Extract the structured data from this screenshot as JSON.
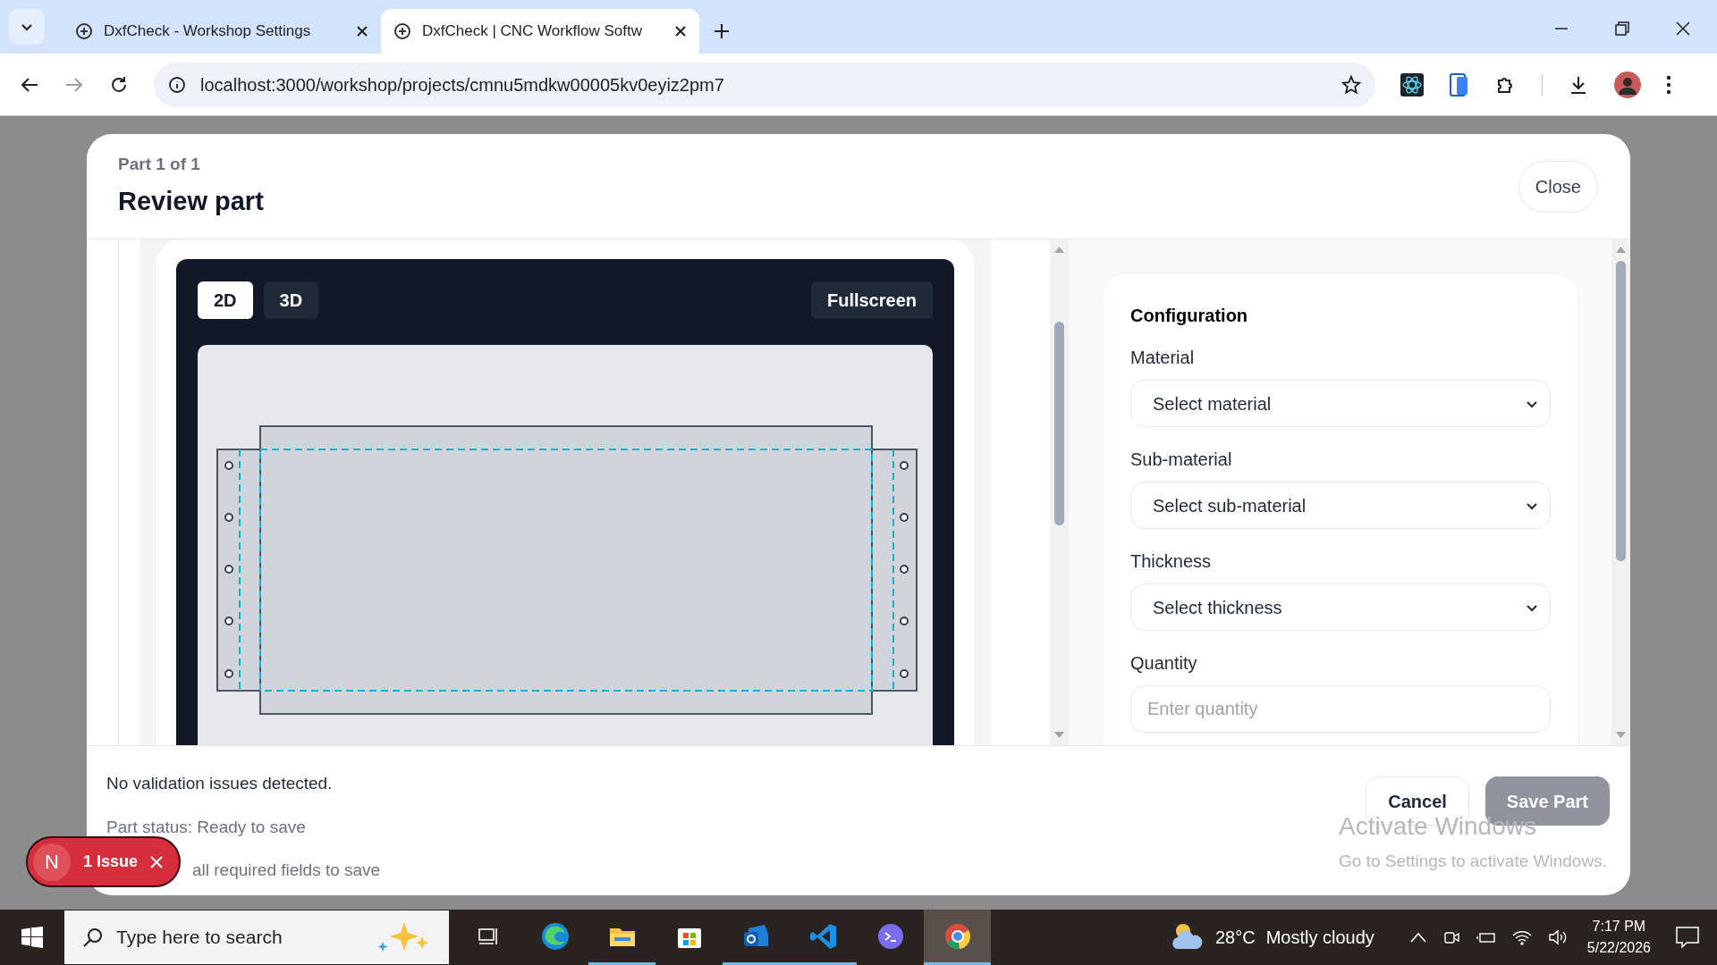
{
  "browser": {
    "tabs": [
      {
        "title": "DxfCheck - Workshop Settings",
        "selected": false
      },
      {
        "title": "DxfCheck | CNC Workflow Softw",
        "selected": true
      }
    ],
    "url": "localhost:3000/workshop/projects/cmnu5mdkw00005kv0eyiz2pm7"
  },
  "modal": {
    "subtitle": "Part 1 of 1",
    "title": "Review part",
    "close": "Close"
  },
  "viewer": {
    "modes": [
      {
        "label": "2D",
        "selected": true
      },
      {
        "label": "3D",
        "selected": false
      }
    ],
    "fullscreen": "Fullscreen"
  },
  "configuration": {
    "title": "Configuration",
    "fields": [
      {
        "label": "Material",
        "kind": "select",
        "value": "Select material"
      },
      {
        "label": "Sub-material",
        "kind": "select",
        "value": "Select sub-material"
      },
      {
        "label": "Thickness",
        "kind": "select",
        "value": "Select thickness"
      },
      {
        "label": "Quantity",
        "kind": "input",
        "placeholder": "Enter quantity"
      }
    ]
  },
  "footer": {
    "messages": [
      "No validation issues detected.",
      "Part status: Ready to save",
      "all required fields to save"
    ],
    "cancel": "Cancel",
    "save": {
      "label": "Save Part",
      "disabled": true
    }
  },
  "issue_badge": {
    "letter": "N",
    "label": "1 Issue"
  },
  "os_notice": {
    "title": "Activate Windows",
    "text": "Go to Settings to activate Windows."
  },
  "taskbar": {
    "search_placeholder": "Type here to search",
    "temperature": "28°C",
    "weather": "Mostly cloudy",
    "time": "7:17 PM",
    "date": "5/22/2026",
    "apps": [
      {
        "kind": "taskview",
        "running": false,
        "selected": false
      },
      {
        "kind": "edge",
        "running": false,
        "selected": false
      },
      {
        "kind": "explorer",
        "running": true,
        "selected": false
      },
      {
        "kind": "store",
        "running": false,
        "selected": false
      },
      {
        "kind": "outlook",
        "running": true,
        "selected": false
      },
      {
        "kind": "vscode",
        "running": true,
        "selected": false
      },
      {
        "kind": "terminal",
        "running": false,
        "selected": false
      },
      {
        "kind": "chrome",
        "running": true,
        "selected": true
      }
    ]
  }
}
